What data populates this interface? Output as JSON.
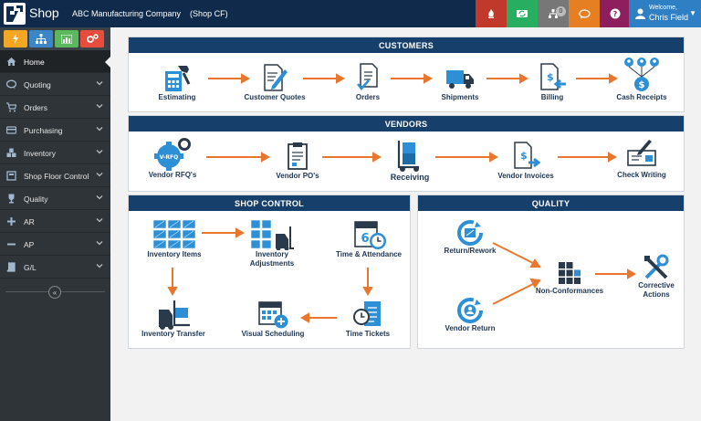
{
  "header": {
    "app_name": "Shop",
    "company": "ABC Manufacturing Company    (Shop CF)",
    "notification_count": "0",
    "welcome": "Welcome,",
    "user_name": "Chris Field",
    "buttons": [
      {
        "name": "alert-icon",
        "color": "#c0392b"
      },
      {
        "name": "sync-icon",
        "color": "#27ae60"
      },
      {
        "name": "org-chart-icon",
        "color": "#777777"
      },
      {
        "name": "chat-icon",
        "color": "#e67e22"
      },
      {
        "name": "help-icon",
        "color": "#8e1e5e"
      }
    ]
  },
  "quick_buttons": [
    {
      "name": "bolt-icon",
      "color": "#f5a623"
    },
    {
      "name": "hierarchy-icon",
      "color": "#3a86c8"
    },
    {
      "name": "bar-chart-icon",
      "color": "#5cb85c"
    },
    {
      "name": "gears-icon",
      "color": "#e74c3c"
    }
  ],
  "nav": {
    "items": [
      {
        "label": "Home",
        "icon": "home-icon"
      },
      {
        "label": "Quoting",
        "icon": "quote-icon"
      },
      {
        "label": "Orders",
        "icon": "cart-icon"
      },
      {
        "label": "Purchasing",
        "icon": "card-icon"
      },
      {
        "label": "Inventory",
        "icon": "cubes-icon"
      },
      {
        "label": "Shop Floor Control",
        "icon": "shop-floor-icon"
      },
      {
        "label": "Quality",
        "icon": "trophy-icon"
      },
      {
        "label": "AR",
        "icon": "plus-icon"
      },
      {
        "label": "AP",
        "icon": "minus-icon"
      },
      {
        "label": "G/L",
        "icon": "book-icon"
      }
    ],
    "collapse_glyph": "«"
  },
  "customers": {
    "title": "CUSTOMERS",
    "steps": [
      "Estimating",
      "Customer Quotes",
      "Orders",
      "Shipments",
      "Billing",
      "Cash Receipts"
    ]
  },
  "vendors": {
    "title": "VENDORS",
    "steps": [
      "Vendor RFQ's",
      "Vendor PO's",
      "Receiving",
      "Vendor Invoices",
      "Check Writing"
    ],
    "rfq_badge": "V-RFQ"
  },
  "shop_control": {
    "title": "SHOP CONTROL",
    "inventory_items": "Inventory Items",
    "inventory_adjustments": "Inventory\nAdjustments",
    "time_attendance": "Time & Attendance",
    "calendar_day": "6",
    "inventory_transfer": "Inventory Transfer",
    "visual_scheduling": "Visual Scheduling",
    "time_tickets": "Time Tickets"
  },
  "quality": {
    "title": "QUALITY",
    "return_rework": "Return/Rework",
    "vendor_return": "Vendor Return",
    "non_conformances": "Non-Conformances",
    "corrective_actions": "Corrective\nActions"
  },
  "colors": {
    "navy": "#163f6b",
    "arrow": "#e8762d",
    "icon_blue": "#2d8fd5",
    "icon_dark": "#2b3a4a"
  }
}
